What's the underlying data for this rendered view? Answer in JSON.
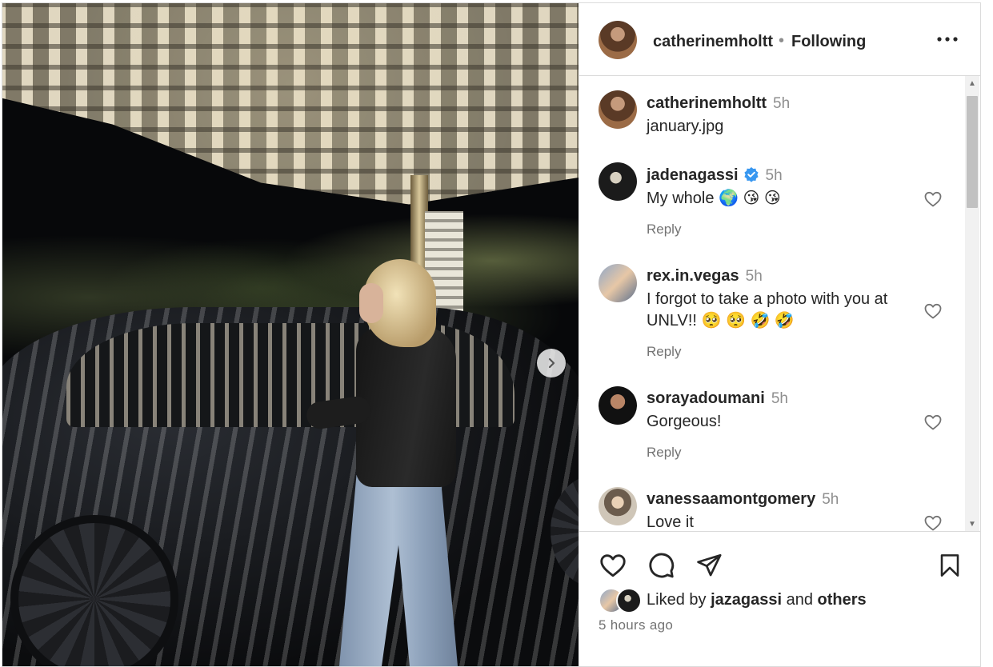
{
  "post": {
    "author": "catherinemholtt",
    "follow_status": "Following",
    "separator": "•"
  },
  "comments": [
    {
      "user": "catherinemholtt",
      "time": "5h",
      "text": "january.jpg",
      "verified": false
    },
    {
      "user": "jadenagassi",
      "time": "5h",
      "text": "My whole 🌍 😘 😘",
      "verified": true,
      "reply_label": "Reply"
    },
    {
      "user": "rex.in.vegas",
      "time": "5h",
      "text": "I forgot to take a photo with you at UNLV!! 🥺 🥺 🤣 🤣",
      "verified": false,
      "reply_label": "Reply"
    },
    {
      "user": "sorayadoumani",
      "time": "5h",
      "text": "Gorgeous!",
      "verified": false,
      "reply_label": "Reply"
    },
    {
      "user": "vanessaamontgomery",
      "time": "5h",
      "text": "Love it",
      "verified": false
    }
  ],
  "likes": {
    "prefix": "Liked by",
    "user": "jazagassi",
    "conjunction": "and",
    "others": "others"
  },
  "timestamp": "5 hours ago",
  "icons": {
    "like": "heart-icon",
    "comment": "comment-bubble-icon",
    "share": "paper-plane-icon",
    "save": "bookmark-icon",
    "more": "more-options-icon",
    "next": "chevron-right-icon",
    "verified": "verified-badge-icon"
  },
  "colors": {
    "verified": "#3897f0",
    "secondary_text": "#737373",
    "primary_text": "#262626",
    "border": "#dbdbdb"
  }
}
